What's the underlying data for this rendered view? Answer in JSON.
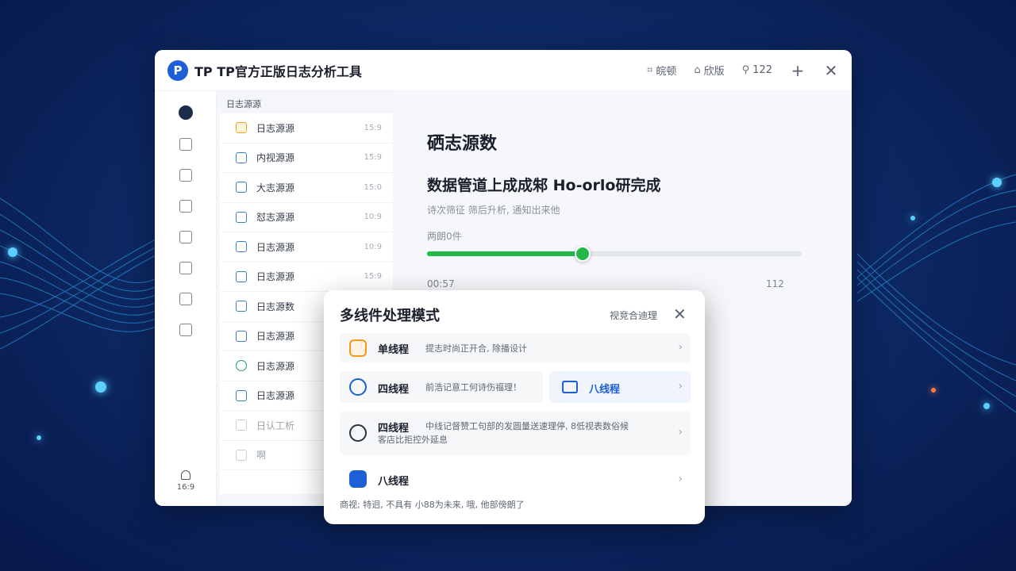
{
  "window": {
    "logo_letter": "P",
    "title": "TP TP官方正版日志分析工具",
    "actions": [
      {
        "icon": "tag-icon",
        "label": "皖顿"
      },
      {
        "icon": "lock-icon",
        "label": "欣版"
      },
      {
        "icon": "search-icon",
        "label": "122"
      }
    ]
  },
  "rail": {
    "icons": [
      "rocket-icon",
      "document-icon",
      "file-icon",
      "database-icon",
      "server-icon",
      "folder-icon",
      "monitor-icon",
      "bag-icon"
    ],
    "bottom_label": "16:9"
  },
  "sources": {
    "header": "日志源源",
    "items": [
      {
        "label": "日志源源",
        "meta": "15:9"
      },
      {
        "label": "内视源源",
        "meta": "15:9"
      },
      {
        "label": "大志源源",
        "meta": "15:0"
      },
      {
        "label": "怼志源源",
        "meta": "10:9"
      },
      {
        "label": "日志源源",
        "meta": "10:9"
      },
      {
        "label": "日志源源",
        "meta": "15:9"
      },
      {
        "label": "日志源数",
        "meta": ""
      },
      {
        "label": "日志源源",
        "meta": ""
      },
      {
        "label": "日志源源",
        "meta": ""
      },
      {
        "label": "日志源源",
        "meta": ""
      },
      {
        "label": "日认工析",
        "meta": ""
      },
      {
        "label": "啊",
        "meta": ""
      }
    ]
  },
  "content": {
    "title": "硒志源数",
    "subtitle": "数据管道上成成邾 Ho-orlo研完成",
    "description": "诗次筛征 筛后升析, 通知出来他",
    "progress_label": "两朗0件",
    "progress": 0.415,
    "time_start": "00:57",
    "time_end": "112"
  },
  "popup": {
    "title": "多线件处理模式",
    "link": "视竞合迪理",
    "rows": [
      {
        "name": "单线程",
        "text": "提志时尚正开合, 除播设计"
      },
      {
        "name": "四线程",
        "text": "前浩记意工何诗伤福理！"
      },
      {
        "name": "四线程",
        "text": "中线记督赞工句部的发圆量送速理停, 8低视表数俗候",
        "text2": "客店比拒控外延息"
      },
      {
        "name": "八线程",
        "text": ""
      }
    ],
    "half_option": {
      "name": "八线程"
    },
    "bottom_text": "商视; 特迥, 不具有 小88为未来, 哦, 他部傍朗了"
  },
  "colors": {
    "accent": "#1d5fd6",
    "progress": "#22b84a",
    "background": "#0d2a66"
  }
}
